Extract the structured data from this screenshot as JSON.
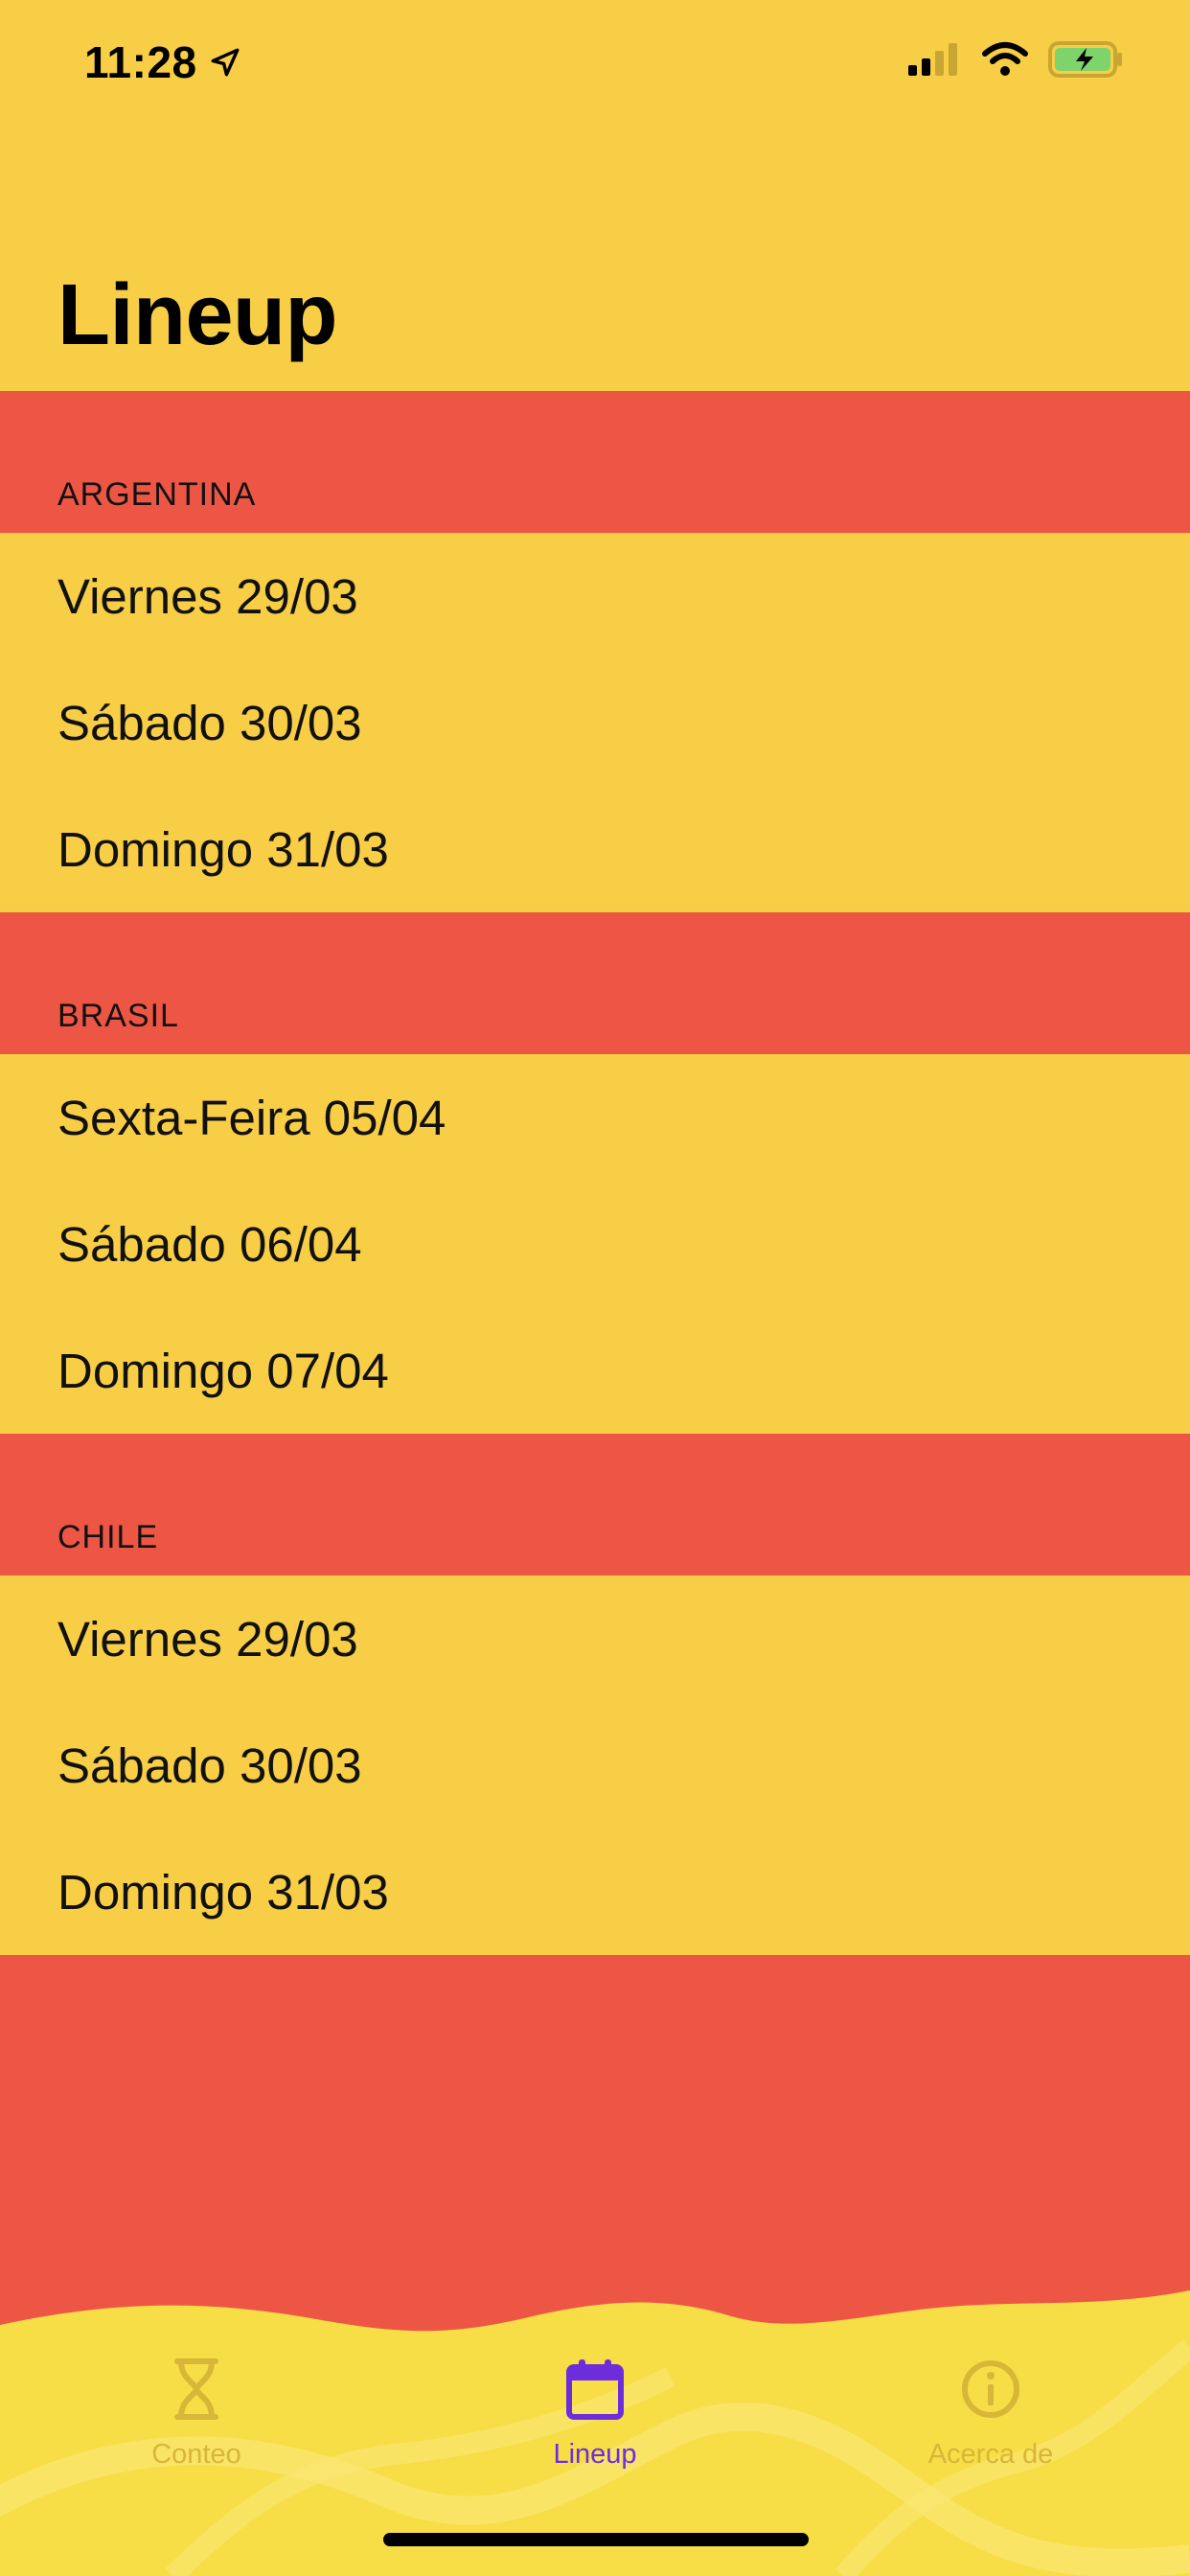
{
  "status_bar": {
    "time": "11:28"
  },
  "header": {
    "title": "Lineup"
  },
  "sections": [
    {
      "title": "ARGENTINA",
      "items": [
        "Viernes 29/03",
        "Sábado 30/03",
        "Domingo 31/03"
      ]
    },
    {
      "title": "BRASIL",
      "items": [
        "Sexta-Feira 05/04",
        "Sábado 06/04",
        "Domingo 07/04"
      ]
    },
    {
      "title": "CHILE",
      "items": [
        "Viernes 29/03",
        "Sábado 30/03",
        "Domingo 31/03"
      ]
    }
  ],
  "tabbar": {
    "tabs": [
      {
        "label": "Conteo",
        "icon": "hourglass-icon",
        "active": false
      },
      {
        "label": "Lineup",
        "icon": "calendar-icon",
        "active": true
      },
      {
        "label": "Acerca de",
        "icon": "info-icon",
        "active": false
      }
    ]
  },
  "colors": {
    "yellow": "#F8CE46",
    "red": "#ED5645",
    "tab_yellow": "#F7DD46",
    "active_purple": "#6E2DDC",
    "inactive_tab": "#D8B637"
  }
}
